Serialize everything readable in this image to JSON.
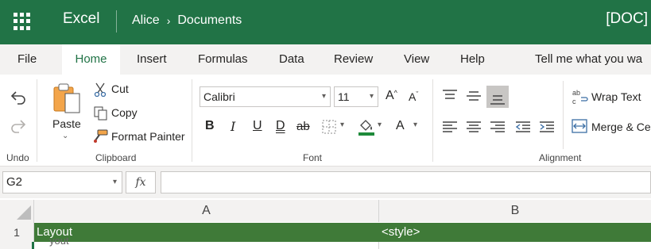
{
  "titlebar": {
    "app_name": "Excel",
    "breadcrumb": [
      "Alice",
      "Documents"
    ],
    "doc_type": "[DOC]",
    "color": "#217346"
  },
  "tabs": {
    "items": [
      "File",
      "Home",
      "Insert",
      "Formulas",
      "Data",
      "Review",
      "View",
      "Help"
    ],
    "active": "Home",
    "tell_me": "Tell me what you wa"
  },
  "ribbon": {
    "undo": {
      "group_label": "Undo"
    },
    "clipboard": {
      "paste": "Paste",
      "cut": "Cut",
      "copy": "Copy",
      "format_painter": "Format Painter",
      "group_label": "Clipboard"
    },
    "font": {
      "font_name": "Calibri",
      "font_size": "11",
      "grow": "A",
      "shrink": "A",
      "bold": "B",
      "italic": "I",
      "underline": "U",
      "double_underline": "D",
      "strike": "ab",
      "font_color": "A",
      "group_label": "Font"
    },
    "alignment": {
      "wrap_text": "Wrap Text",
      "merge": "Merge & Cer",
      "group_label": "Alignment"
    }
  },
  "formula_bar": {
    "name_box": "G2",
    "fx": "fx",
    "value": ""
  },
  "grid": {
    "columns": [
      "A",
      "B"
    ],
    "rows": [
      {
        "number": "1",
        "cells": [
          "Layout",
          "<style>"
        ]
      }
    ],
    "partial_row_text": "yout",
    "header_row_color": "#3f7a38"
  }
}
